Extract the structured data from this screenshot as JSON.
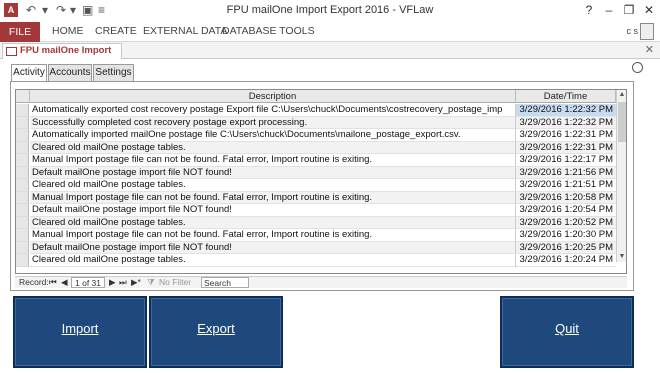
{
  "window": {
    "app_icon": "A",
    "title": "FPU mailOne Import Export 2016 - VFLaw",
    "user": "c s",
    "help": "?"
  },
  "ribbon": {
    "file": "FILE",
    "tabs": [
      "HOME",
      "CREATE",
      "EXTERNAL DATA",
      "DATABASE TOOLS"
    ]
  },
  "document": {
    "tab_label": "FPU mailOne Import Export"
  },
  "subtabs": [
    "Activity",
    "Accounts",
    "Settings"
  ],
  "grid": {
    "columns": {
      "description": "Description",
      "date": "Date/Time"
    },
    "rows": [
      {
        "description": "Automatically exported cost recovery postage Export file C:\\Users\\chuck\\Documents\\costrecovery_postage_imp",
        "date": "3/29/2016 1:22:32 PM"
      },
      {
        "description": "Successfully completed cost recovery postage export processing.",
        "date": "3/29/2016 1:22:32 PM"
      },
      {
        "description": "Automatically imported mailOne postage file C:\\Users\\chuck\\Documents\\mailone_postage_export.csv.",
        "date": "3/29/2016 1:22:31 PM"
      },
      {
        "description": "Cleared old mailOne postage tables.",
        "date": "3/29/2016 1:22:31 PM"
      },
      {
        "description": "Manual Import postage file can not be found. Fatal error, Import routine is exiting.",
        "date": "3/29/2016 1:22:17 PM"
      },
      {
        "description": "Default mailOne postage import file NOT found!",
        "date": "3/29/2016 1:21:56 PM"
      },
      {
        "description": "Cleared old mailOne postage tables.",
        "date": "3/29/2016 1:21:51 PM"
      },
      {
        "description": "Manual Import postage file can not be found. Fatal error, Import routine is exiting.",
        "date": "3/29/2016 1:20:58 PM"
      },
      {
        "description": "Default mailOne postage import file NOT found!",
        "date": "3/29/2016 1:20:54 PM"
      },
      {
        "description": "Cleared old mailOne postage tables.",
        "date": "3/29/2016 1:20:52 PM"
      },
      {
        "description": "Manual Import postage file can not be found. Fatal error, Import routine is exiting.",
        "date": "3/29/2016 1:20:30 PM"
      },
      {
        "description": "Default mailOne postage import file NOT found!",
        "date": "3/29/2016 1:20:25 PM"
      },
      {
        "description": "Cleared old mailOne postage tables.",
        "date": "3/29/2016 1:20:24 PM"
      }
    ]
  },
  "navigation": {
    "record_label": "Record:",
    "position": "1 of 31",
    "filter": "No Filter",
    "search_placeholder": "Search"
  },
  "buttons": {
    "import": "Import",
    "export": "Export",
    "quit": "Quit"
  },
  "colors": {
    "accent": "#a4373a",
    "button": "#1f497d",
    "selected": "#c6dbf1"
  }
}
